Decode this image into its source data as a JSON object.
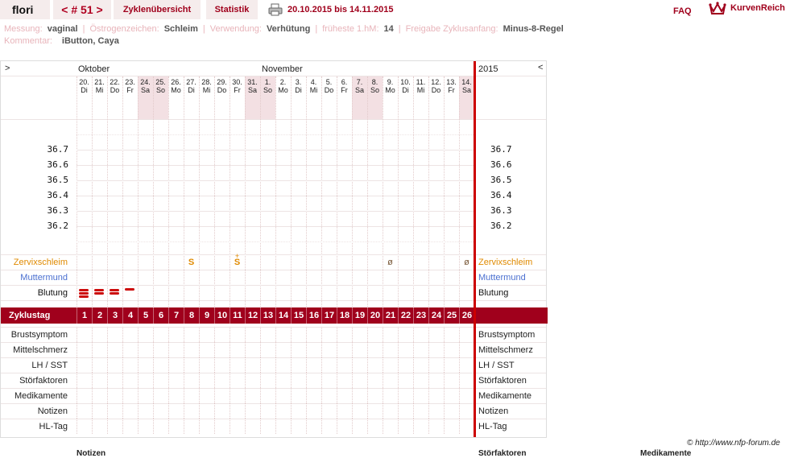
{
  "header": {
    "user": "flori",
    "cycle_label": "< # 51 >",
    "cycle_prev": "<",
    "cycle_number": "# 51",
    "cycle_next": ">",
    "tab_overview": "Zyklenübersicht",
    "tab_stats": "Statistik",
    "print_icon": "printer-icon",
    "date_range": "20.10.2015 bis 14.11.2015",
    "faq": "FAQ",
    "brand": "KurvenReich"
  },
  "info": {
    "messung_label": "Messung:",
    "messung": "vaginal",
    "oestrogen_label": "Östrogenzeichen:",
    "oestrogen": "Schleim",
    "verwendung_label": "Verwendung:",
    "verwendung": "Verhütung",
    "hm_label": "früheste 1.hM:",
    "hm": "14",
    "freigabe_label": "Freigabe Zyklusanfang:",
    "freigabe": "Minus-8-Regel",
    "kommentar_label": "Kommentar:",
    "kommentar": "iButton, Caya"
  },
  "chart": {
    "nav_left": ">",
    "nav_right": "<",
    "month1": "Oktober",
    "month2": "November",
    "year": "2015",
    "days": [
      {
        "d": "20.",
        "w": "Di"
      },
      {
        "d": "21.",
        "w": "Mi"
      },
      {
        "d": "22.",
        "w": "Do"
      },
      {
        "d": "23.",
        "w": "Fr"
      },
      {
        "d": "24.",
        "w": "Sa"
      },
      {
        "d": "25.",
        "w": "So"
      },
      {
        "d": "26.",
        "w": "Mo"
      },
      {
        "d": "27.",
        "w": "Di"
      },
      {
        "d": "28.",
        "w": "Mi"
      },
      {
        "d": "29.",
        "w": "Do"
      },
      {
        "d": "30.",
        "w": "Fr"
      },
      {
        "d": "31.",
        "w": "Sa"
      },
      {
        "d": "1.",
        "w": "So"
      },
      {
        "d": "2.",
        "w": "Mo"
      },
      {
        "d": "3.",
        "w": "Di"
      },
      {
        "d": "4.",
        "w": "Mi"
      },
      {
        "d": "5.",
        "w": "Do"
      },
      {
        "d": "6.",
        "w": "Fr"
      },
      {
        "d": "7.",
        "w": "Sa"
      },
      {
        "d": "8.",
        "w": "So"
      },
      {
        "d": "9.",
        "w": "Mo"
      },
      {
        "d": "10.",
        "w": "Di"
      },
      {
        "d": "11.",
        "w": "Mi"
      },
      {
        "d": "12.",
        "w": "Do"
      },
      {
        "d": "13.",
        "w": "Fr"
      },
      {
        "d": "14.",
        "w": "Sa"
      }
    ],
    "temps": [
      "36.7",
      "36.6",
      "36.5",
      "36.4",
      "36.3",
      "36.2"
    ],
    "row_zervix": "Zervixschleim",
    "row_muttermund": "Muttermund",
    "row_blutung": "Blutung",
    "row_zyklustag": "Zyklustag",
    "rows_bottom": [
      "Brustsymptom",
      "Mittelschmerz",
      "LH / SST",
      "Störfaktoren",
      "Medikamente",
      "Notizen",
      "HL-Tag"
    ],
    "zervix_marks": [
      {
        "day": 8,
        "sym": "S"
      },
      {
        "day": 11,
        "sym": "S+"
      },
      {
        "day": 21,
        "sym": "ø"
      },
      {
        "day": 26,
        "sym": "ø"
      }
    ],
    "blutung": [
      {
        "day": 1,
        "level": "stark"
      },
      {
        "day": 2,
        "level": "mittel"
      },
      {
        "day": 3,
        "level": "mittel"
      },
      {
        "day": 4,
        "level": "leicht"
      }
    ],
    "colors": {
      "accent": "#a0001c",
      "zervix": "#e08a00",
      "muttermund": "#4a6fd0",
      "weekend": "#f3e0e3",
      "cycle_end": "#cc0000"
    }
  },
  "footer": {
    "copyright": "© http://www.nfp-forum.de",
    "notizen": "Notizen",
    "stoerfaktoren": "Störfaktoren",
    "medikamente": "Medikamente"
  }
}
